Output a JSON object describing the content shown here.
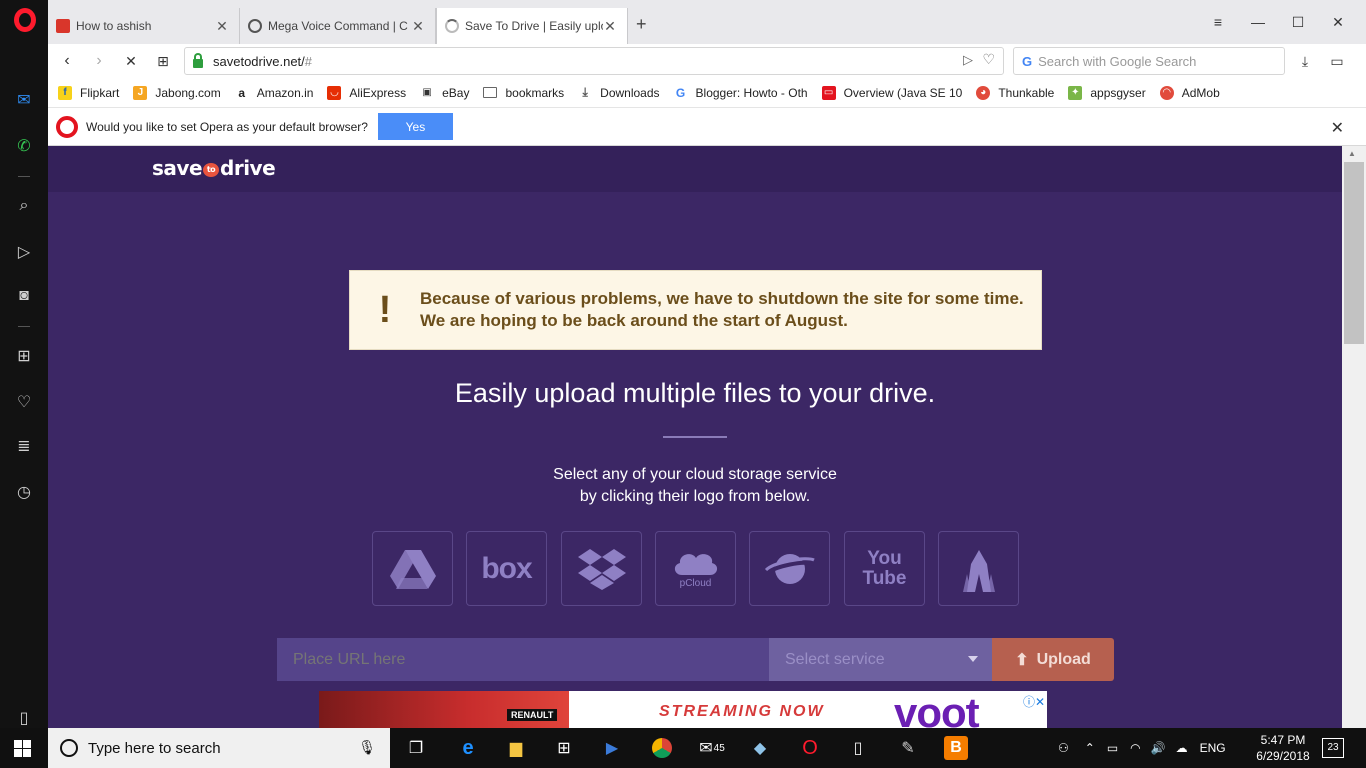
{
  "tabs": [
    {
      "label": "How to ashish",
      "favicon_color": "#d9362b"
    },
    {
      "label": "Mega Voice Command | C",
      "favicon_color": "#555555"
    },
    {
      "label": "Save To Drive | Easily uplo",
      "favicon_color": "#999999"
    }
  ],
  "address": {
    "url": "savetodrive.net/",
    "hash": "#",
    "search_placeholder": "Search with Google Search"
  },
  "bookmarks": [
    {
      "label": "Flipkart",
      "icon": "flipkart-icon",
      "color": "#f7d21a"
    },
    {
      "label": "Jabong.com",
      "icon": "jabong-icon",
      "color": "#f5a623"
    },
    {
      "label": "Amazon.in",
      "icon": "amazon-icon",
      "color": "#222222"
    },
    {
      "label": "AliExpress",
      "icon": "aliexpress-icon",
      "color": "#e62e04"
    },
    {
      "label": "eBay",
      "icon": "ebay-icon",
      "color": "#444444"
    },
    {
      "label": "bookmarks",
      "icon": "folder-icon",
      "color": "#666666"
    },
    {
      "label": "Downloads",
      "icon": "download-icon",
      "color": "#666666"
    },
    {
      "label": "Blogger: Howto - Oth",
      "icon": "google-icon",
      "color": "#4285f4"
    },
    {
      "label": "Overview (Java SE 10",
      "icon": "opera-icon",
      "color": "#e3141f"
    },
    {
      "label": "Thunkable",
      "icon": "thunkable-icon",
      "color": "#e14b3c"
    },
    {
      "label": "appsgyser",
      "icon": "appsgyser-icon",
      "color": "#7ab648"
    },
    {
      "label": "AdMob",
      "icon": "admob-icon",
      "color": "#e14b3c"
    }
  ],
  "default_bar": {
    "text": "Would you like to set Opera as your default browser?",
    "yes_label": "Yes"
  },
  "site": {
    "logo_left": "save",
    "logo_mid": "to",
    "logo_right": "drive",
    "notice_line1": "Because of various problems, we have to shutdown the site for some time.",
    "notice_line2": "We are hoping to be back around the start of August.",
    "headline": "Easily upload multiple files to your drive.",
    "sub_line1": "Select any of your cloud storage service",
    "sub_line2": "by clicking their logo from below.",
    "services": [
      {
        "name": "google-drive",
        "label": ""
      },
      {
        "name": "box",
        "label": "box"
      },
      {
        "name": "dropbox",
        "label": ""
      },
      {
        "name": "pcloud",
        "label": "pCloud"
      },
      {
        "name": "mediafire",
        "label": ""
      },
      {
        "name": "youtube",
        "label": "You Tube"
      },
      {
        "name": "yandex",
        "label": ""
      }
    ],
    "url_placeholder": "Place URL here",
    "select_label": "Select service",
    "upload_label": "Upload"
  },
  "ad": {
    "word": "voot",
    "stream_text": "STREAMING NOW",
    "brand": "RENAULT"
  },
  "taskbar": {
    "search_placeholder": "Type here to search",
    "mail_badge": "45",
    "language": "ENG",
    "time": "5:47 PM",
    "date": "6/29/2018",
    "notifications": "23"
  }
}
